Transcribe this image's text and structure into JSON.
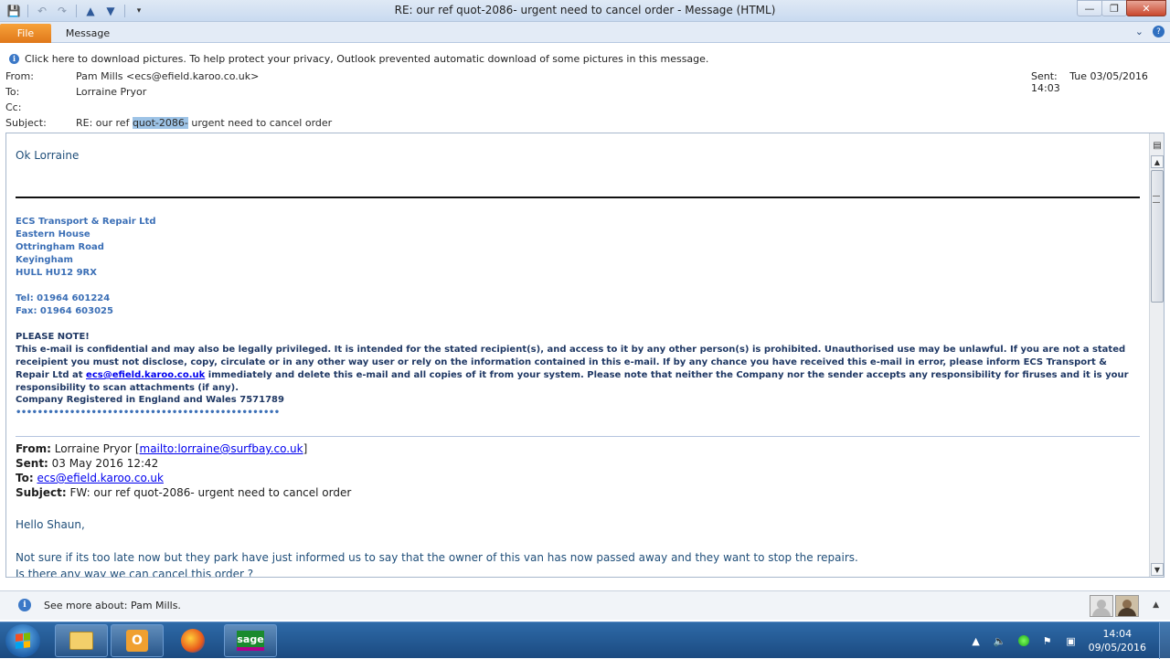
{
  "window": {
    "title": "RE: our ref quot-2086- urgent need to cancel order  -  Message (HTML)",
    "minimize": "—",
    "restore": "❐",
    "close": "✕"
  },
  "quick_access": {
    "save_icon": "save-icon",
    "undo_icon": "undo-icon",
    "redo_icon": "redo-icon",
    "up_icon": "previous-item-icon",
    "down_icon": "next-item-icon",
    "customize_icon": "customize-icon"
  },
  "ribbon": {
    "file_tab": "File",
    "message_tab": "Message"
  },
  "infobar": {
    "text": "Click here to download pictures. To help protect your privacy, Outlook prevented automatic download of some pictures in this message."
  },
  "header": {
    "from_label": "From:",
    "from_value": "Pam Mills <ecs@efield.karoo.co.uk>",
    "to_label": "To:",
    "to_value": "Lorraine Pryor",
    "cc_label": "Cc:",
    "subject_label": "Subject:",
    "subject_prefix": "RE: our ref ",
    "subject_highlight": "quot-2086-",
    "subject_suffix": " urgent need to cancel order",
    "sent_label": "Sent:",
    "sent_value": "Tue 03/05/2016 14:03"
  },
  "body": {
    "greeting": "Ok Lorraine",
    "signature": [
      "ECS Transport & Repair Ltd",
      "Eastern House",
      "Ottringham Road",
      "Keyingham",
      "HULL    HU12 9RX",
      "",
      "Tel: 01964 601224",
      "Fax: 01964 603025"
    ],
    "note_title": "PLEASE NOTE!",
    "note_text_1": "This e-mail is confidential and may also be legally privileged.  It is intended for the stated recipient(s), and access to it by any other person(s) is prohibited.  Unauthorised use may be unlawful.  If you are not a stated receipient you must not disclose, copy, circulate or in any other way user or rely on the information contained in this e-mail.  If by any chance you have received this e-mail in error, please inform ECS Transport & Repair Ltd at ",
    "note_link": "ecs@efield.karoo.co.uk",
    "note_text_2": " immediately and delete this e-mail and all copies of it from your system.  Please note that neither the Company nor the sender accepts any responsibility for firuses and it is your responsibility to scan attachments (if any).",
    "registered": "Company Registered in England and Wales 7571789",
    "dots": "•••••••••••••••••••••••••••••••••••••••••••••••••",
    "fwd": {
      "from_label": "From:",
      "from_value": " Lorraine Pryor [",
      "from_link": "mailto:lorraine@surfbay.co.uk",
      "from_close": "]",
      "sent_label": "Sent:",
      "sent_value": " 03 May 2016 12:42",
      "to_label": "To:",
      "to_link": "ecs@efield.karoo.co.uk",
      "subject_label": "Subject:",
      "subject_value": " FW: our ref quot-2086- urgent need to cancel order"
    },
    "hello": "Hello Shaun,",
    "para1": "Not sure if its too late now but they park have just informed us to say that the owner of this van has now passed away and they want to stop the repairs.",
    "para2": "Is there any way we can cancel this order ?"
  },
  "people_pane": {
    "text": "See more about: Pam Mills."
  },
  "taskbar": {
    "time": "14:04",
    "date": "09/05/2016",
    "sage_label": "sage",
    "outlook_label": "O"
  }
}
